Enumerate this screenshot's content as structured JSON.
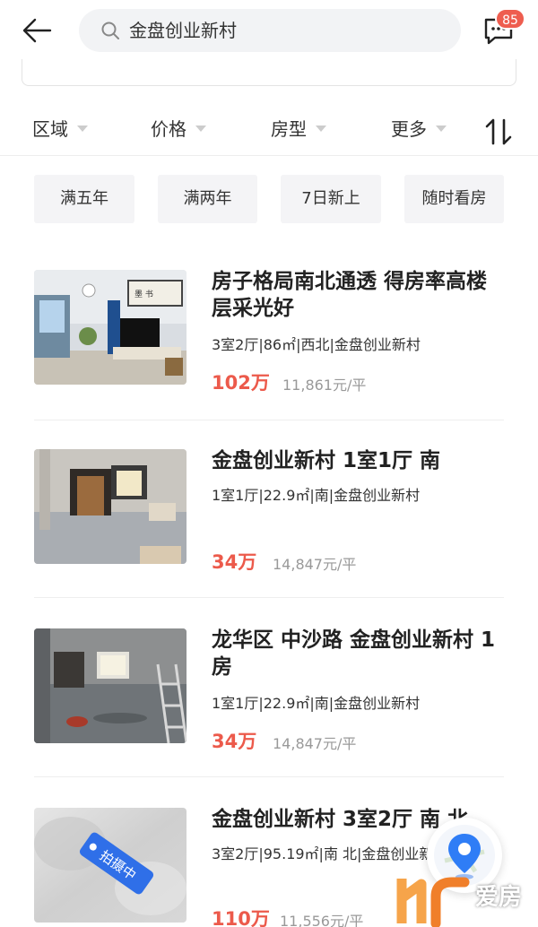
{
  "header": {
    "search_text": "金盘创业新村",
    "badge_count": "85"
  },
  "filters": [
    {
      "label": "区域"
    },
    {
      "label": "价格"
    },
    {
      "label": "房型"
    },
    {
      "label": "更多"
    }
  ],
  "tags": [
    "满五年",
    "满两年",
    "7日新上",
    "随时看房"
  ],
  "listings": [
    {
      "title": "房子格局南北通透 得房率高楼层采光好",
      "meta": "3室2厅|86㎡|西北|金盘创业新村",
      "price": "102万",
      "unit_price": "11,861元/平"
    },
    {
      "title": "金盘创业新村 1室1厅 南",
      "meta": "1室1厅|22.9㎡|南|金盘创业新村",
      "price": "34万",
      "unit_price": "14,847元/平"
    },
    {
      "title": "龙华区 中沙路 金盘创业新村 1房",
      "meta": "1室1厅|22.9㎡|南|金盘创业新村",
      "price": "34万",
      "unit_price": "14,847元/平"
    },
    {
      "title": "金盘创业新村 3室2厅 南 北",
      "meta": "3室2厅|95.19㎡|南 北|金盘创业新村",
      "price": "110万",
      "unit_price": "11,556元/平",
      "photo_badge": "拍摄中"
    }
  ],
  "watermark": {
    "text": "爱房"
  },
  "colors": {
    "accent": "#ec5a4b",
    "badge": "#ee5d4f",
    "tag_bg": "#f4f4f6",
    "map_pin": "#2f7df6"
  }
}
